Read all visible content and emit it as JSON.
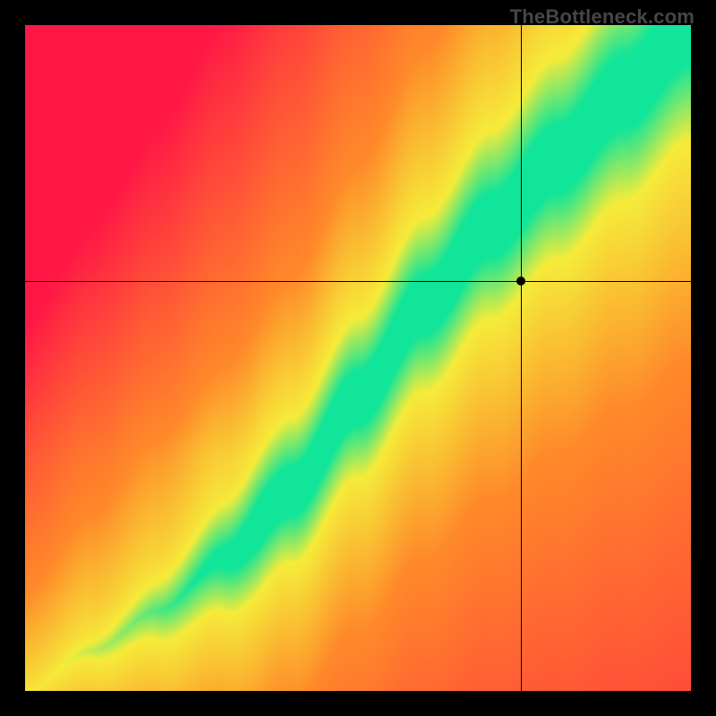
{
  "watermark": "TheBottleneck.com",
  "chart_data": {
    "type": "heatmap",
    "title": "",
    "xlabel": "",
    "ylabel": "",
    "xlim": [
      0,
      1
    ],
    "ylim": [
      0,
      1
    ],
    "legend": false,
    "crosshair": {
      "x": 0.745,
      "y": 0.615
    },
    "marker": {
      "x": 0.745,
      "y": 0.615
    },
    "ridge_control_points": [
      {
        "x": 0.0,
        "y": 0.0
      },
      {
        "x": 0.1,
        "y": 0.06
      },
      {
        "x": 0.2,
        "y": 0.12
      },
      {
        "x": 0.3,
        "y": 0.2
      },
      {
        "x": 0.4,
        "y": 0.3
      },
      {
        "x": 0.5,
        "y": 0.44
      },
      {
        "x": 0.6,
        "y": 0.58
      },
      {
        "x": 0.7,
        "y": 0.7
      },
      {
        "x": 0.8,
        "y": 0.8
      },
      {
        "x": 0.9,
        "y": 0.9
      },
      {
        "x": 1.0,
        "y": 1.0
      }
    ],
    "colors": {
      "ridge": "#11e59a",
      "near": "#f6ec3a",
      "mid": "#ff8a2a",
      "far": "#ff1846"
    },
    "description": "2D heatmap showing a narrow green optimal band running diagonally from bottom-left to top-right with slight S-curvature; surrounded by yellow then orange then red gradient indicating increasing mismatch distance from the band. A crosshair and marker are placed at approximately (0.745, 0.615) in normalized coordinates, just below/right of the green band."
  }
}
